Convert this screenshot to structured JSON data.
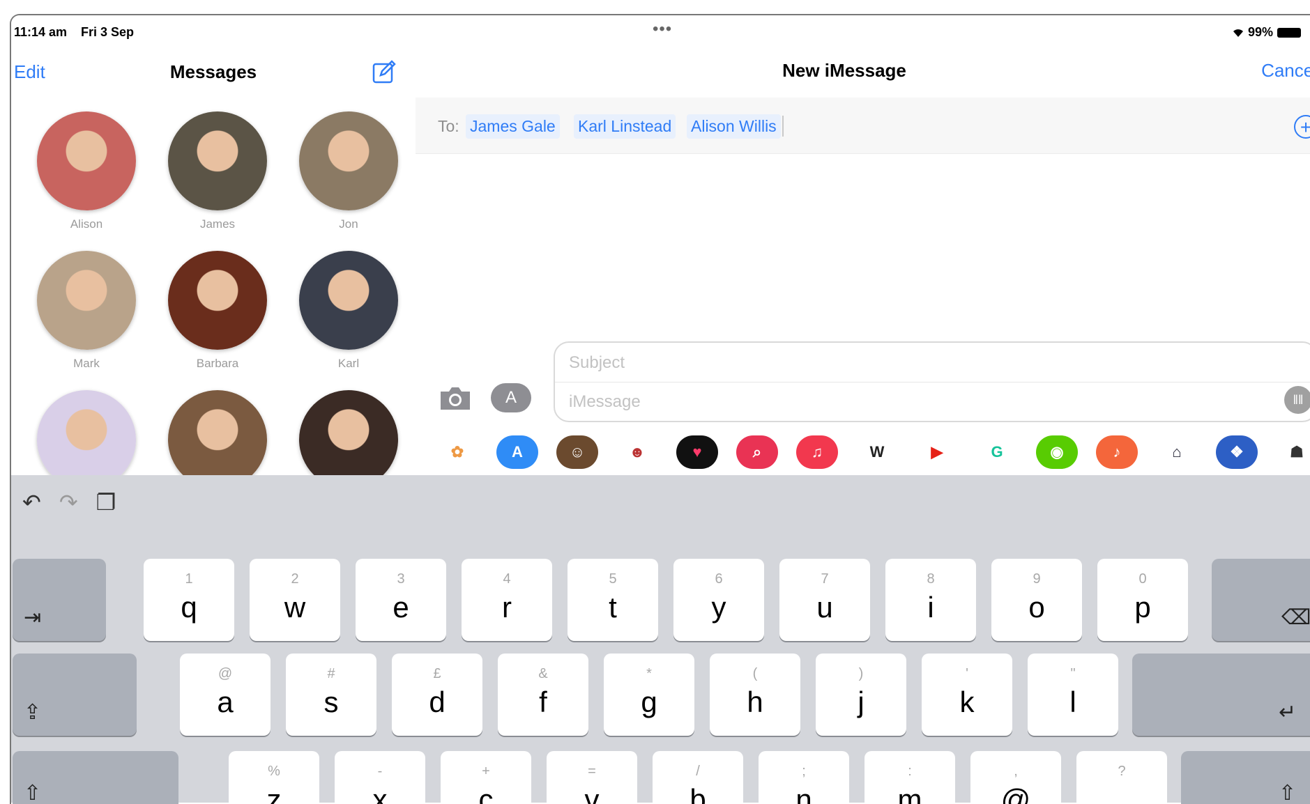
{
  "status": {
    "time": "11:14 am",
    "date": "Fri 3 Sep",
    "battery": "99%"
  },
  "sidebar": {
    "edit_label": "Edit",
    "title": "Messages",
    "contacts": [
      {
        "name": "Alison",
        "color": "#c8645f"
      },
      {
        "name": "James",
        "color": "#5b5446"
      },
      {
        "name": "Jon",
        "color": "#8b7a64"
      },
      {
        "name": "Mark",
        "color": "#b9a38a"
      },
      {
        "name": "Barbara",
        "color": "#6a2d1c"
      },
      {
        "name": "Karl",
        "color": "#3a3f4c"
      },
      {
        "name": "",
        "color": "#d9cfe8"
      },
      {
        "name": "",
        "color": "#7b5a40"
      },
      {
        "name": "",
        "color": "#3b2b25"
      }
    ]
  },
  "conversation": {
    "more_dots": "•••",
    "title": "New iMessage",
    "cancel_label": "Cancel",
    "to_label": "To:",
    "recipients": [
      "James Gale",
      "Karl Linstead",
      "Alison Willis"
    ],
    "subject_placeholder": "Subject",
    "message_placeholder": "iMessage"
  },
  "app_strip": [
    {
      "icon": "photos-icon",
      "color": "#ffffff",
      "glyph": "✿",
      "fg": "#e94"
    },
    {
      "icon": "app-store-icon",
      "color": "#2f8cf6",
      "glyph": "A",
      "fg": "#fff"
    },
    {
      "icon": "memoji-icon",
      "color": "#6b4a2e",
      "glyph": "☺",
      "fg": "#fff"
    },
    {
      "icon": "memoji-sticker-icon",
      "color": "#ffffff",
      "glyph": "☻",
      "fg": "#b33"
    },
    {
      "icon": "digital-touch-icon",
      "color": "#111111",
      "glyph": "♥",
      "fg": "#ff3b6b"
    },
    {
      "icon": "images-search-icon",
      "color": "#e93354",
      "glyph": "⌕",
      "fg": "#fff"
    },
    {
      "icon": "music-icon",
      "color": "#f2384e",
      "glyph": "♫",
      "fg": "#fff"
    },
    {
      "icon": "wikipedia-icon",
      "color": "#ffffff",
      "glyph": "W",
      "fg": "#222"
    },
    {
      "icon": "youtube-icon",
      "color": "#ffffff",
      "glyph": "▶",
      "fg": "#e62117"
    },
    {
      "icon": "grammarly-icon",
      "color": "#ffffff",
      "glyph": "G",
      "fg": "#15c39a"
    },
    {
      "icon": "duolingo-icon",
      "color": "#58cc02",
      "glyph": "◉",
      "fg": "#fff"
    },
    {
      "icon": "garageband-icon",
      "color": "#f4663b",
      "glyph": "♪",
      "fg": "#fff"
    },
    {
      "icon": "batman-icon",
      "color": "#ffffff",
      "glyph": "⌂",
      "fg": "#223"
    },
    {
      "icon": "dropbox-icon",
      "color": "#2d5fc5",
      "glyph": "❖",
      "fg": "#fff"
    },
    {
      "icon": "sticker-pack-icon",
      "color": "#ffffff",
      "glyph": "☗",
      "fg": "#333"
    }
  ],
  "keyboard": {
    "row1": [
      {
        "ch": "q",
        "hint": "1"
      },
      {
        "ch": "w",
        "hint": "2"
      },
      {
        "ch": "e",
        "hint": "3"
      },
      {
        "ch": "r",
        "hint": "4"
      },
      {
        "ch": "t",
        "hint": "5"
      },
      {
        "ch": "y",
        "hint": "6"
      },
      {
        "ch": "u",
        "hint": "7"
      },
      {
        "ch": "i",
        "hint": "8"
      },
      {
        "ch": "o",
        "hint": "9"
      },
      {
        "ch": "p",
        "hint": "0"
      }
    ],
    "row2": [
      {
        "ch": "a",
        "hint": "@"
      },
      {
        "ch": "s",
        "hint": "#"
      },
      {
        "ch": "d",
        "hint": "£"
      },
      {
        "ch": "f",
        "hint": "&"
      },
      {
        "ch": "g",
        "hint": "*"
      },
      {
        "ch": "h",
        "hint": "("
      },
      {
        "ch": "j",
        "hint": ")"
      },
      {
        "ch": "k",
        "hint": "'"
      },
      {
        "ch": "l",
        "hint": "\""
      }
    ],
    "row3": [
      {
        "ch": "z",
        "hint": "%"
      },
      {
        "ch": "x",
        "hint": "-"
      },
      {
        "ch": "c",
        "hint": "+"
      },
      {
        "ch": "v",
        "hint": "="
      },
      {
        "ch": "b",
        "hint": "/"
      },
      {
        "ch": "n",
        "hint": ";"
      },
      {
        "ch": "m",
        "hint": ":"
      },
      {
        "ch": "@",
        "hint": ","
      },
      {
        "ch": ".",
        "hint": "?"
      }
    ]
  }
}
